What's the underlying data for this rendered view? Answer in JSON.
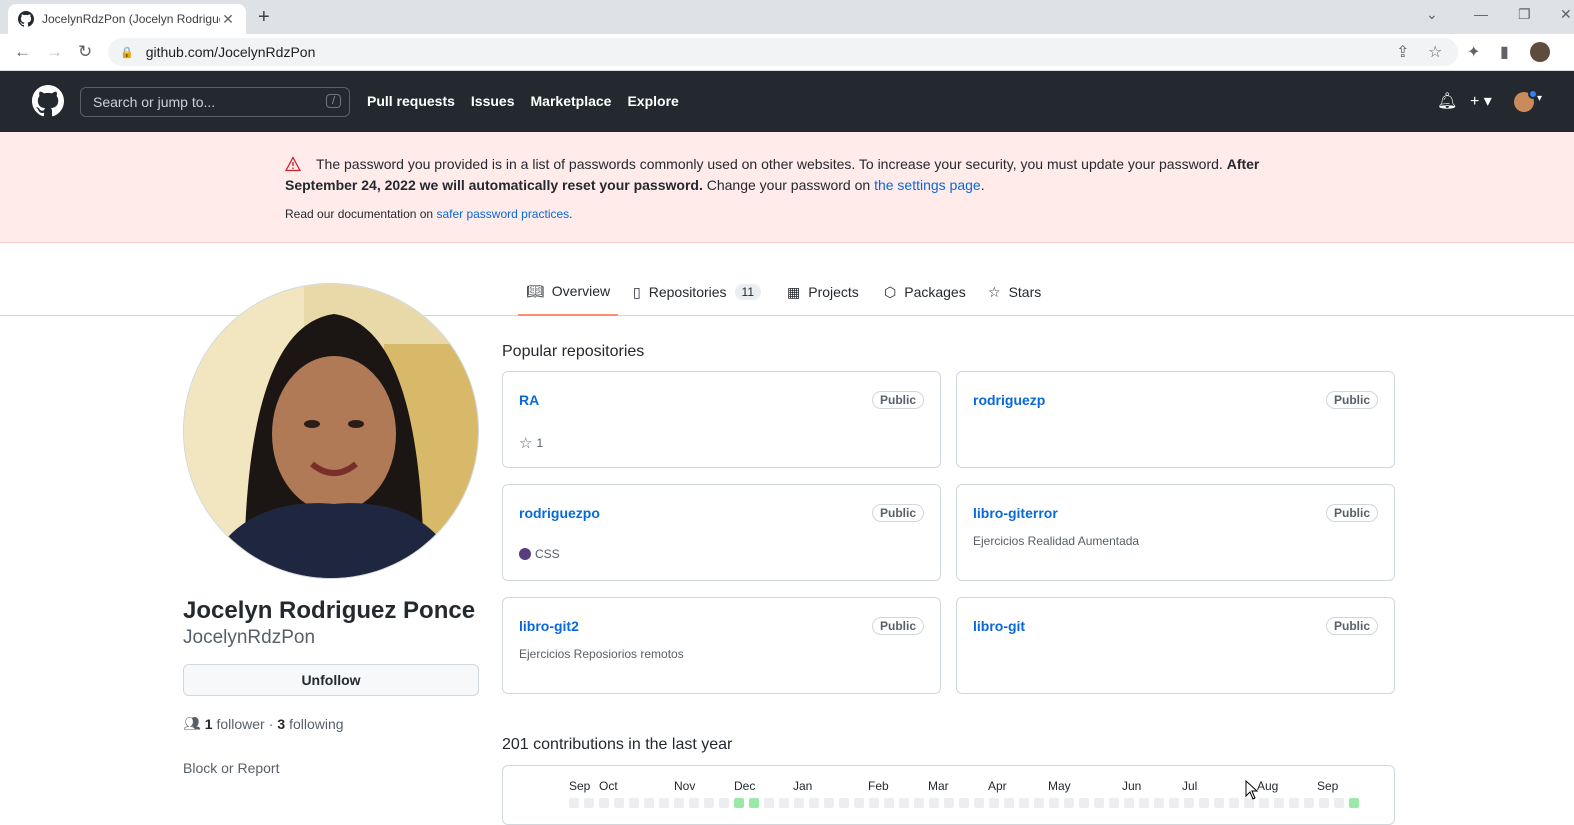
{
  "browser": {
    "tab_title": "JocelynRdzPon (Jocelyn Rodrigue",
    "url": "github.com/JocelynRdzPon"
  },
  "header": {
    "search_placeholder": "Search or jump to...",
    "search_shortcut": "/",
    "nav": [
      "Pull requests",
      "Issues",
      "Marketplace",
      "Explore"
    ]
  },
  "flash": {
    "text_1": "The password you provided is in a list of passwords commonly used on other websites. To increase your security, you must update your password. ",
    "text_bold": "After September 24, 2022 we will automatically reset your password.",
    "text_2": " Change your password on ",
    "settings_link": "the settings page",
    "text_3": ".",
    "docs_prefix": "Read our documentation on ",
    "docs_link": "safer password practices",
    "docs_suffix": "."
  },
  "tabs": [
    {
      "label": "Overview",
      "icon": "book-icon"
    },
    {
      "label": "Repositories",
      "icon": "repo-icon",
      "count": "11"
    },
    {
      "label": "Projects",
      "icon": "table-icon"
    },
    {
      "label": "Packages",
      "icon": "package-icon"
    },
    {
      "label": "Stars",
      "icon": "star-icon"
    }
  ],
  "profile": {
    "name": "Jocelyn Rodriguez Ponce",
    "login": "JocelynRdzPon",
    "unfollow": "Unfollow",
    "followers_count": "1",
    "followers_label": "follower",
    "separator": "·",
    "following_count": "3",
    "following_label": "following",
    "block": "Block or Report"
  },
  "popular": {
    "title": "Popular repositories",
    "repos": [
      {
        "name": "RA",
        "badge": "Public",
        "stars": "1"
      },
      {
        "name": "rodriguezp",
        "badge": "Public"
      },
      {
        "name": "rodriguezpo",
        "badge": "Public",
        "language": "CSS"
      },
      {
        "name": "libro-giterror",
        "badge": "Public",
        "description": "Ejercicios Realidad Aumentada"
      },
      {
        "name": "libro-git2",
        "badge": "Public",
        "description": "Ejercicios Reposiorios remotos"
      },
      {
        "name": "libro-git",
        "badge": "Public"
      }
    ]
  },
  "contributions": {
    "title": "201 contributions in the last year",
    "months": [
      "Sep",
      "Oct",
      "Nov",
      "Dec",
      "Jan",
      "Feb",
      "Mar",
      "Apr",
      "May",
      "Jun",
      "Jul",
      "Aug",
      "Sep"
    ]
  },
  "colors": {
    "header_bg": "#24292f",
    "flash_bg": "#ffebe9",
    "link": "#0969da",
    "tab_underline": "#fd8c73",
    "css_lang": "#563d7c"
  }
}
